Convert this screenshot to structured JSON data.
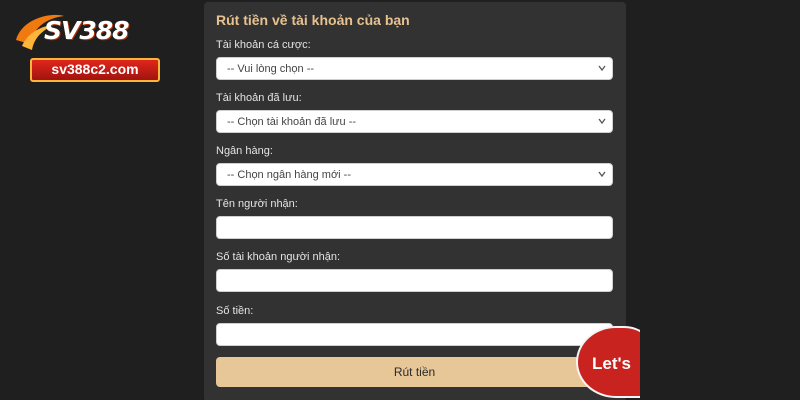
{
  "logo": {
    "brand": "SV388",
    "domain": "sv388c2.com",
    "colors": {
      "banner": "#c81e15",
      "border": "#ffb43a",
      "swoosh": "#f07a10"
    }
  },
  "form": {
    "title": "Rút tiền về tài khoản của bạn",
    "fields": [
      {
        "label": "Tài khoản cá cược:",
        "type": "select",
        "value": "-- Vui lòng chọn --"
      },
      {
        "label": "Tài khoản đã lưu:",
        "type": "select",
        "value": "-- Chọn tài khoản đã lưu --"
      },
      {
        "label": "Ngân hàng:",
        "type": "select",
        "value": "-- Chọn ngân hàng mới --"
      },
      {
        "label": "Tên người nhận:",
        "type": "input",
        "value": ""
      },
      {
        "label": "Số tài khoản người nhận:",
        "type": "input",
        "value": ""
      },
      {
        "label": "Số tiền:",
        "type": "input",
        "value": ""
      }
    ],
    "submit_label": "Rút tiền",
    "colors": {
      "title": "#e7c28f",
      "button": "#e7c797",
      "panel": "#323232"
    }
  },
  "chat": {
    "label": "Let's",
    "icon": "chat-bubble-icon",
    "color": "#c8231f"
  }
}
